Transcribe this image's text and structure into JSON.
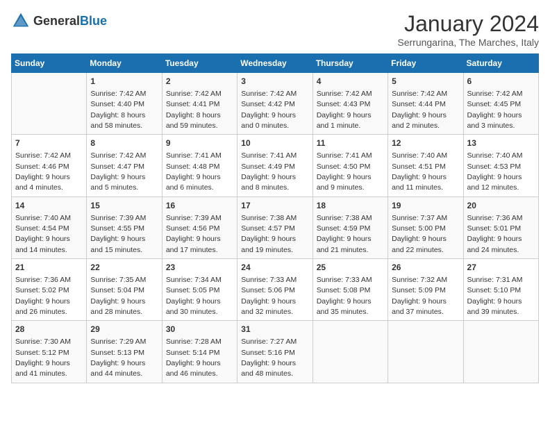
{
  "header": {
    "logo_general": "General",
    "logo_blue": "Blue",
    "month": "January 2024",
    "location": "Serrungarina, The Marches, Italy"
  },
  "days_of_week": [
    "Sunday",
    "Monday",
    "Tuesday",
    "Wednesday",
    "Thursday",
    "Friday",
    "Saturday"
  ],
  "weeks": [
    [
      {
        "day": "",
        "sunrise": "",
        "sunset": "",
        "daylight": ""
      },
      {
        "day": "1",
        "sunrise": "Sunrise: 7:42 AM",
        "sunset": "Sunset: 4:40 PM",
        "daylight": "Daylight: 8 hours and 58 minutes."
      },
      {
        "day": "2",
        "sunrise": "Sunrise: 7:42 AM",
        "sunset": "Sunset: 4:41 PM",
        "daylight": "Daylight: 8 hours and 59 minutes."
      },
      {
        "day": "3",
        "sunrise": "Sunrise: 7:42 AM",
        "sunset": "Sunset: 4:42 PM",
        "daylight": "Daylight: 9 hours and 0 minutes."
      },
      {
        "day": "4",
        "sunrise": "Sunrise: 7:42 AM",
        "sunset": "Sunset: 4:43 PM",
        "daylight": "Daylight: 9 hours and 1 minute."
      },
      {
        "day": "5",
        "sunrise": "Sunrise: 7:42 AM",
        "sunset": "Sunset: 4:44 PM",
        "daylight": "Daylight: 9 hours and 2 minutes."
      },
      {
        "day": "6",
        "sunrise": "Sunrise: 7:42 AM",
        "sunset": "Sunset: 4:45 PM",
        "daylight": "Daylight: 9 hours and 3 minutes."
      }
    ],
    [
      {
        "day": "7",
        "sunrise": "Sunrise: 7:42 AM",
        "sunset": "Sunset: 4:46 PM",
        "daylight": "Daylight: 9 hours and 4 minutes."
      },
      {
        "day": "8",
        "sunrise": "Sunrise: 7:42 AM",
        "sunset": "Sunset: 4:47 PM",
        "daylight": "Daylight: 9 hours and 5 minutes."
      },
      {
        "day": "9",
        "sunrise": "Sunrise: 7:41 AM",
        "sunset": "Sunset: 4:48 PM",
        "daylight": "Daylight: 9 hours and 6 minutes."
      },
      {
        "day": "10",
        "sunrise": "Sunrise: 7:41 AM",
        "sunset": "Sunset: 4:49 PM",
        "daylight": "Daylight: 9 hours and 8 minutes."
      },
      {
        "day": "11",
        "sunrise": "Sunrise: 7:41 AM",
        "sunset": "Sunset: 4:50 PM",
        "daylight": "Daylight: 9 hours and 9 minutes."
      },
      {
        "day": "12",
        "sunrise": "Sunrise: 7:40 AM",
        "sunset": "Sunset: 4:51 PM",
        "daylight": "Daylight: 9 hours and 11 minutes."
      },
      {
        "day": "13",
        "sunrise": "Sunrise: 7:40 AM",
        "sunset": "Sunset: 4:53 PM",
        "daylight": "Daylight: 9 hours and 12 minutes."
      }
    ],
    [
      {
        "day": "14",
        "sunrise": "Sunrise: 7:40 AM",
        "sunset": "Sunset: 4:54 PM",
        "daylight": "Daylight: 9 hours and 14 minutes."
      },
      {
        "day": "15",
        "sunrise": "Sunrise: 7:39 AM",
        "sunset": "Sunset: 4:55 PM",
        "daylight": "Daylight: 9 hours and 15 minutes."
      },
      {
        "day": "16",
        "sunrise": "Sunrise: 7:39 AM",
        "sunset": "Sunset: 4:56 PM",
        "daylight": "Daylight: 9 hours and 17 minutes."
      },
      {
        "day": "17",
        "sunrise": "Sunrise: 7:38 AM",
        "sunset": "Sunset: 4:57 PM",
        "daylight": "Daylight: 9 hours and 19 minutes."
      },
      {
        "day": "18",
        "sunrise": "Sunrise: 7:38 AM",
        "sunset": "Sunset: 4:59 PM",
        "daylight": "Daylight: 9 hours and 21 minutes."
      },
      {
        "day": "19",
        "sunrise": "Sunrise: 7:37 AM",
        "sunset": "Sunset: 5:00 PM",
        "daylight": "Daylight: 9 hours and 22 minutes."
      },
      {
        "day": "20",
        "sunrise": "Sunrise: 7:36 AM",
        "sunset": "Sunset: 5:01 PM",
        "daylight": "Daylight: 9 hours and 24 minutes."
      }
    ],
    [
      {
        "day": "21",
        "sunrise": "Sunrise: 7:36 AM",
        "sunset": "Sunset: 5:02 PM",
        "daylight": "Daylight: 9 hours and 26 minutes."
      },
      {
        "day": "22",
        "sunrise": "Sunrise: 7:35 AM",
        "sunset": "Sunset: 5:04 PM",
        "daylight": "Daylight: 9 hours and 28 minutes."
      },
      {
        "day": "23",
        "sunrise": "Sunrise: 7:34 AM",
        "sunset": "Sunset: 5:05 PM",
        "daylight": "Daylight: 9 hours and 30 minutes."
      },
      {
        "day": "24",
        "sunrise": "Sunrise: 7:33 AM",
        "sunset": "Sunset: 5:06 PM",
        "daylight": "Daylight: 9 hours and 32 minutes."
      },
      {
        "day": "25",
        "sunrise": "Sunrise: 7:33 AM",
        "sunset": "Sunset: 5:08 PM",
        "daylight": "Daylight: 9 hours and 35 minutes."
      },
      {
        "day": "26",
        "sunrise": "Sunrise: 7:32 AM",
        "sunset": "Sunset: 5:09 PM",
        "daylight": "Daylight: 9 hours and 37 minutes."
      },
      {
        "day": "27",
        "sunrise": "Sunrise: 7:31 AM",
        "sunset": "Sunset: 5:10 PM",
        "daylight": "Daylight: 9 hours and 39 minutes."
      }
    ],
    [
      {
        "day": "28",
        "sunrise": "Sunrise: 7:30 AM",
        "sunset": "Sunset: 5:12 PM",
        "daylight": "Daylight: 9 hours and 41 minutes."
      },
      {
        "day": "29",
        "sunrise": "Sunrise: 7:29 AM",
        "sunset": "Sunset: 5:13 PM",
        "daylight": "Daylight: 9 hours and 44 minutes."
      },
      {
        "day": "30",
        "sunrise": "Sunrise: 7:28 AM",
        "sunset": "Sunset: 5:14 PM",
        "daylight": "Daylight: 9 hours and 46 minutes."
      },
      {
        "day": "31",
        "sunrise": "Sunrise: 7:27 AM",
        "sunset": "Sunset: 5:16 PM",
        "daylight": "Daylight: 9 hours and 48 minutes."
      },
      {
        "day": "",
        "sunrise": "",
        "sunset": "",
        "daylight": ""
      },
      {
        "day": "",
        "sunrise": "",
        "sunset": "",
        "daylight": ""
      },
      {
        "day": "",
        "sunrise": "",
        "sunset": "",
        "daylight": ""
      }
    ]
  ]
}
